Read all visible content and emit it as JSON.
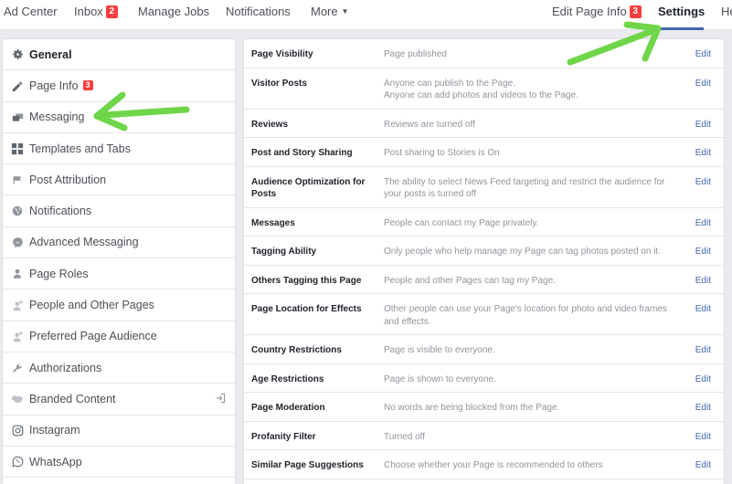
{
  "topnav": {
    "ad_center": "Ad Center",
    "inbox": "Inbox",
    "inbox_badge": "2",
    "manage_jobs": "Manage Jobs",
    "notifications": "Notifications",
    "more": "More",
    "edit_page_info": "Edit Page Info",
    "edit_page_info_badge": "3",
    "settings": "Settings",
    "help_partial": "He"
  },
  "sidebar": {
    "items": [
      {
        "label": "General",
        "icon": "gear-icon"
      },
      {
        "label": "Page Info",
        "icon": "pencil-icon",
        "badge": "3"
      },
      {
        "label": "Messaging",
        "icon": "messaging-icon"
      },
      {
        "label": "Templates and Tabs",
        "icon": "grid-icon"
      },
      {
        "label": "Post Attribution",
        "icon": "flag-icon"
      },
      {
        "label": "Notifications",
        "icon": "globe-icon"
      },
      {
        "label": "Advanced Messaging",
        "icon": "messenger-icon"
      },
      {
        "label": "Page Roles",
        "icon": "person-icon"
      },
      {
        "label": "People and Other Pages",
        "icon": "person-add-icon"
      },
      {
        "label": "Preferred Page Audience",
        "icon": "person-add-icon"
      },
      {
        "label": "Authorizations",
        "icon": "wrench-icon"
      },
      {
        "label": "Branded Content",
        "icon": "handshake-icon"
      },
      {
        "label": "Instagram",
        "icon": "instagram-icon"
      },
      {
        "label": "WhatsApp",
        "icon": "whatsapp-icon"
      }
    ]
  },
  "settings": {
    "edit_label": "Edit",
    "rows": [
      {
        "label": "Page Visibility",
        "desc": "Page published"
      },
      {
        "label": "Visitor Posts",
        "desc": "Anyone can publish to the Page.",
        "desc2": "Anyone can add photos and videos to the Page."
      },
      {
        "label": "Reviews",
        "desc": "Reviews are turned off"
      },
      {
        "label": "Post and Story Sharing",
        "desc": "Post sharing to Stories is On"
      },
      {
        "label": "Audience Optimization for Posts",
        "desc": "The ability to select News Feed targeting and restrict the audience for your posts is turned off"
      },
      {
        "label": "Messages",
        "desc": "People can contact my Page privately."
      },
      {
        "label": "Tagging Ability",
        "desc": "Only people who help manage my Page can tag photos posted on it."
      },
      {
        "label": "Others Tagging this Page",
        "desc": "People and other Pages can tag my Page."
      },
      {
        "label": "Page Location for Effects",
        "desc": "Other people can use your Page's location for photo and video frames and effects."
      },
      {
        "label": "Country Restrictions",
        "desc": "Page is visible to everyone."
      },
      {
        "label": "Age Restrictions",
        "desc": "Page is shown to everyone."
      },
      {
        "label": "Page Moderation",
        "desc": "No words are being blocked from the Page."
      },
      {
        "label": "Profanity Filter",
        "desc": "Turned off"
      },
      {
        "label": "Similar Page Suggestions",
        "desc": "Choose whether your Page is recommended to others"
      }
    ]
  },
  "colors": {
    "accent": "#4267b2",
    "badge": "#fa3e3e",
    "annotation_arrow": "#6fd64a"
  }
}
